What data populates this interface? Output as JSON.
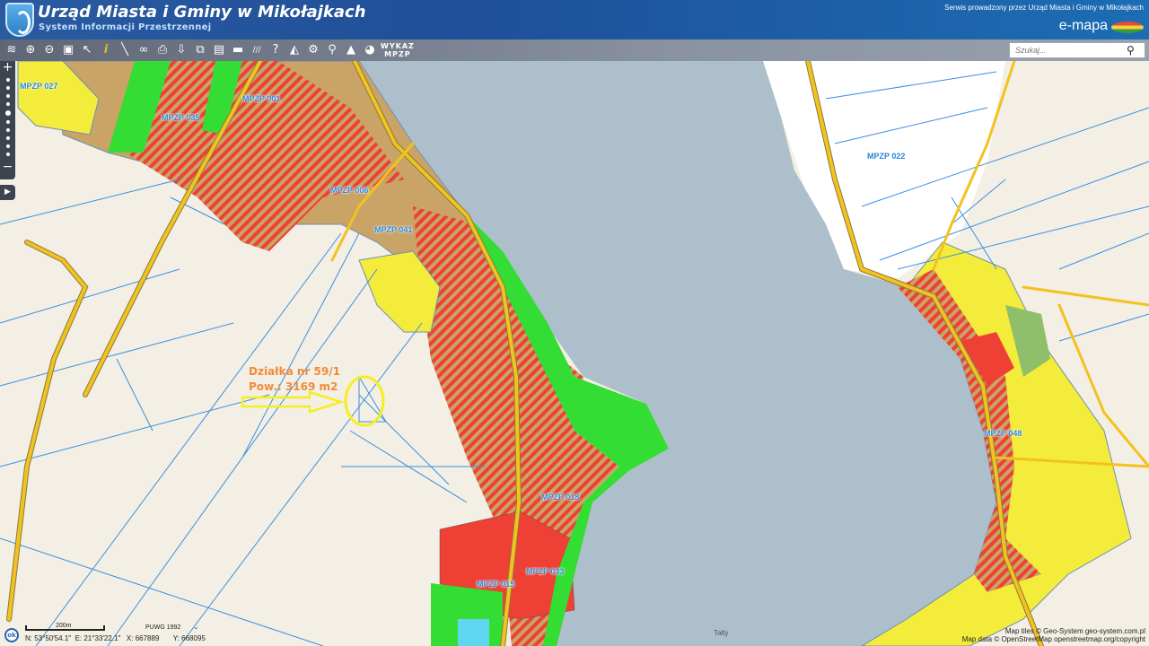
{
  "header": {
    "title": "Urząd Miasta i Gminy w Mikołajkach",
    "subtitle": "System Informacji Przestrzennej",
    "operator": "Serwis prowadzony przez Urząd Miasta i Gminy w Mikołajkach",
    "brand": "e-mapa"
  },
  "toolbar": {
    "tools": [
      {
        "name": "layers-icon",
        "glyph": "≋"
      },
      {
        "name": "zoom-in-icon",
        "glyph": "⊕"
      },
      {
        "name": "zoom-out-icon",
        "glyph": "⊖"
      },
      {
        "name": "full-extent-icon",
        "glyph": "▣"
      },
      {
        "name": "select-arrow-icon",
        "glyph": "↖"
      },
      {
        "name": "info-icon",
        "glyph": "i"
      },
      {
        "name": "measure-icon",
        "glyph": "╲"
      },
      {
        "name": "link-icon",
        "glyph": "∞"
      },
      {
        "name": "print-icon",
        "glyph": "⎙"
      },
      {
        "name": "download-icon",
        "glyph": "⇩"
      },
      {
        "name": "compare-icon",
        "glyph": "⧉"
      },
      {
        "name": "layout-icon",
        "glyph": "▤"
      },
      {
        "name": "comment-icon",
        "glyph": "▬"
      },
      {
        "name": "hatch-icon",
        "glyph": "///"
      },
      {
        "name": "help-icon",
        "glyph": "?"
      },
      {
        "name": "terrain-icon",
        "glyph": "◭"
      },
      {
        "name": "settings-icon",
        "glyph": "⚙"
      },
      {
        "name": "user-location-icon",
        "glyph": "⚲"
      },
      {
        "name": "mountain-icon",
        "glyph": "▲"
      },
      {
        "name": "chat-icon",
        "glyph": "◕"
      }
    ],
    "wykaz_line1": "WYKAZ",
    "wykaz_line2": "MPZP",
    "search_placeholder": "Szukaj..."
  },
  "map": {
    "labels": [
      "MPZP 027",
      "MPZP 035",
      "MPZP 001",
      "MPZP 006",
      "MPZP 041",
      "MPZP 022",
      "MPZP 048",
      "MPZP 018",
      "MPZP 033",
      "MPZP 015"
    ],
    "annotation": {
      "line1": "Działka nr 59/1",
      "line2": "Pow.: 3169 m2"
    },
    "place": "Tałty",
    "colors": {
      "lake": "#aebfcc",
      "residential": "#c9a466",
      "mixed_red": "#ee4034",
      "green": "#33dd33",
      "yellow": "#f4ec3a",
      "road": "#f2c21e",
      "parcel": "#3b8fe0",
      "annotation": "#f08a3a",
      "highlight": "#f5ee22"
    }
  },
  "status": {
    "ok": "ok",
    "scale": "200m",
    "crs": "PUWG 1992",
    "coords": "N: 53°50′54.1″  E: 21°33′22.1″   X: 667889       Y: 668095"
  },
  "attribution": {
    "line1": "Map tiles © Geo-System geo-system.com.pl",
    "line2": "Map data © OpenStreetMap openstreetmap.org/copyright"
  }
}
